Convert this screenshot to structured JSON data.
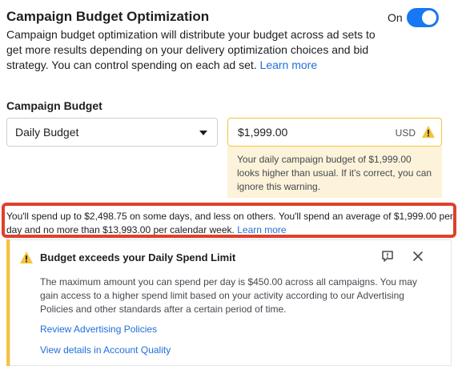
{
  "cbo": {
    "title": "Campaign Budget Optimization",
    "toggle_label": "On",
    "toggle_state": "on",
    "description": "Campaign budget optimization will distribute your budget across ad sets to get more results depending on your delivery optimization choices and bid strategy. You can control spending on each ad set.",
    "learn_more": "Learn more"
  },
  "budget": {
    "label": "Campaign Budget",
    "type_selected": "Daily Budget",
    "amount": "$1,999.00",
    "currency": "USD",
    "warning": "Your daily campaign budget of $1,999.00 looks higher than usual. If it's correct, you can ignore this warning."
  },
  "spend_note": {
    "text": "You'll spend up to $2,498.75 on some days, and less on others. You'll spend an average of $1,999.00 per day and no more than $13,993.00 per calendar week.",
    "learn_more": "Learn more"
  },
  "limit_card": {
    "title": "Budget exceeds your Daily Spend Limit",
    "body": "The maximum amount you can spend per day is $450.00 across all campaigns. You may gain access to a higher spend limit based on your activity according to our Advertising Policies and other standards after a certain period of time.",
    "link_policies": "Review Advertising Policies",
    "link_quality": "View details in Account Quality"
  },
  "colors": {
    "accent": "#1877f2",
    "link": "#216fdb",
    "warning": "#f5c33b",
    "highlight_frame": "#e0402b"
  },
  "icons": [
    "warning-icon",
    "chevron-down-icon",
    "feedback-icon",
    "close-icon"
  ]
}
